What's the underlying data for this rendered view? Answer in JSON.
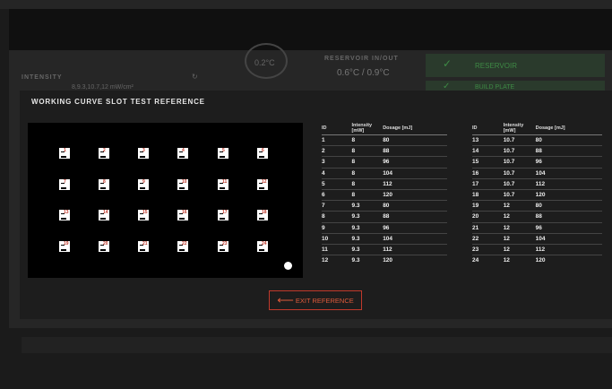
{
  "background": {
    "gauge_value": "0.2°C",
    "reservoir_label": "RESERVOIR IN/OUT",
    "reservoir_value": "0.6°C / 0.9°C",
    "intensity_label": "INTENSITY",
    "intensity_value": "8,9.3,10.7,12 mW/cm²",
    "status1": "RESERVOIR",
    "status2": "BUILD PLATE"
  },
  "modal": {
    "title": "WORKING CURVE SLOT TEST REFERENCE",
    "exit_label": "EXIT REFERENCE"
  },
  "slots": [
    "1",
    "2",
    "3",
    "4",
    "5",
    "6",
    "7",
    "8",
    "9",
    "10",
    "11",
    "12",
    "13",
    "14",
    "15",
    "16",
    "17",
    "18",
    "19",
    "20",
    "21",
    "22",
    "23",
    "24"
  ],
  "table": {
    "headers": [
      "ID",
      "Intensity [mW]",
      "Dosage [mJ]"
    ],
    "left": [
      [
        "1",
        "8",
        "80"
      ],
      [
        "2",
        "8",
        "88"
      ],
      [
        "3",
        "8",
        "96"
      ],
      [
        "4",
        "8",
        "104"
      ],
      [
        "5",
        "8",
        "112"
      ],
      [
        "6",
        "8",
        "120"
      ],
      [
        "7",
        "9.3",
        "80"
      ],
      [
        "8",
        "9.3",
        "88"
      ],
      [
        "9",
        "9.3",
        "96"
      ],
      [
        "10",
        "9.3",
        "104"
      ],
      [
        "11",
        "9.3",
        "112"
      ],
      [
        "12",
        "9.3",
        "120"
      ]
    ],
    "right": [
      [
        "13",
        "10.7",
        "80"
      ],
      [
        "14",
        "10.7",
        "88"
      ],
      [
        "15",
        "10.7",
        "96"
      ],
      [
        "16",
        "10.7",
        "104"
      ],
      [
        "17",
        "10.7",
        "112"
      ],
      [
        "18",
        "10.7",
        "120"
      ],
      [
        "19",
        "12",
        "80"
      ],
      [
        "20",
        "12",
        "88"
      ],
      [
        "21",
        "12",
        "96"
      ],
      [
        "22",
        "12",
        "104"
      ],
      [
        "23",
        "12",
        "112"
      ],
      [
        "24",
        "12",
        "120"
      ]
    ]
  }
}
